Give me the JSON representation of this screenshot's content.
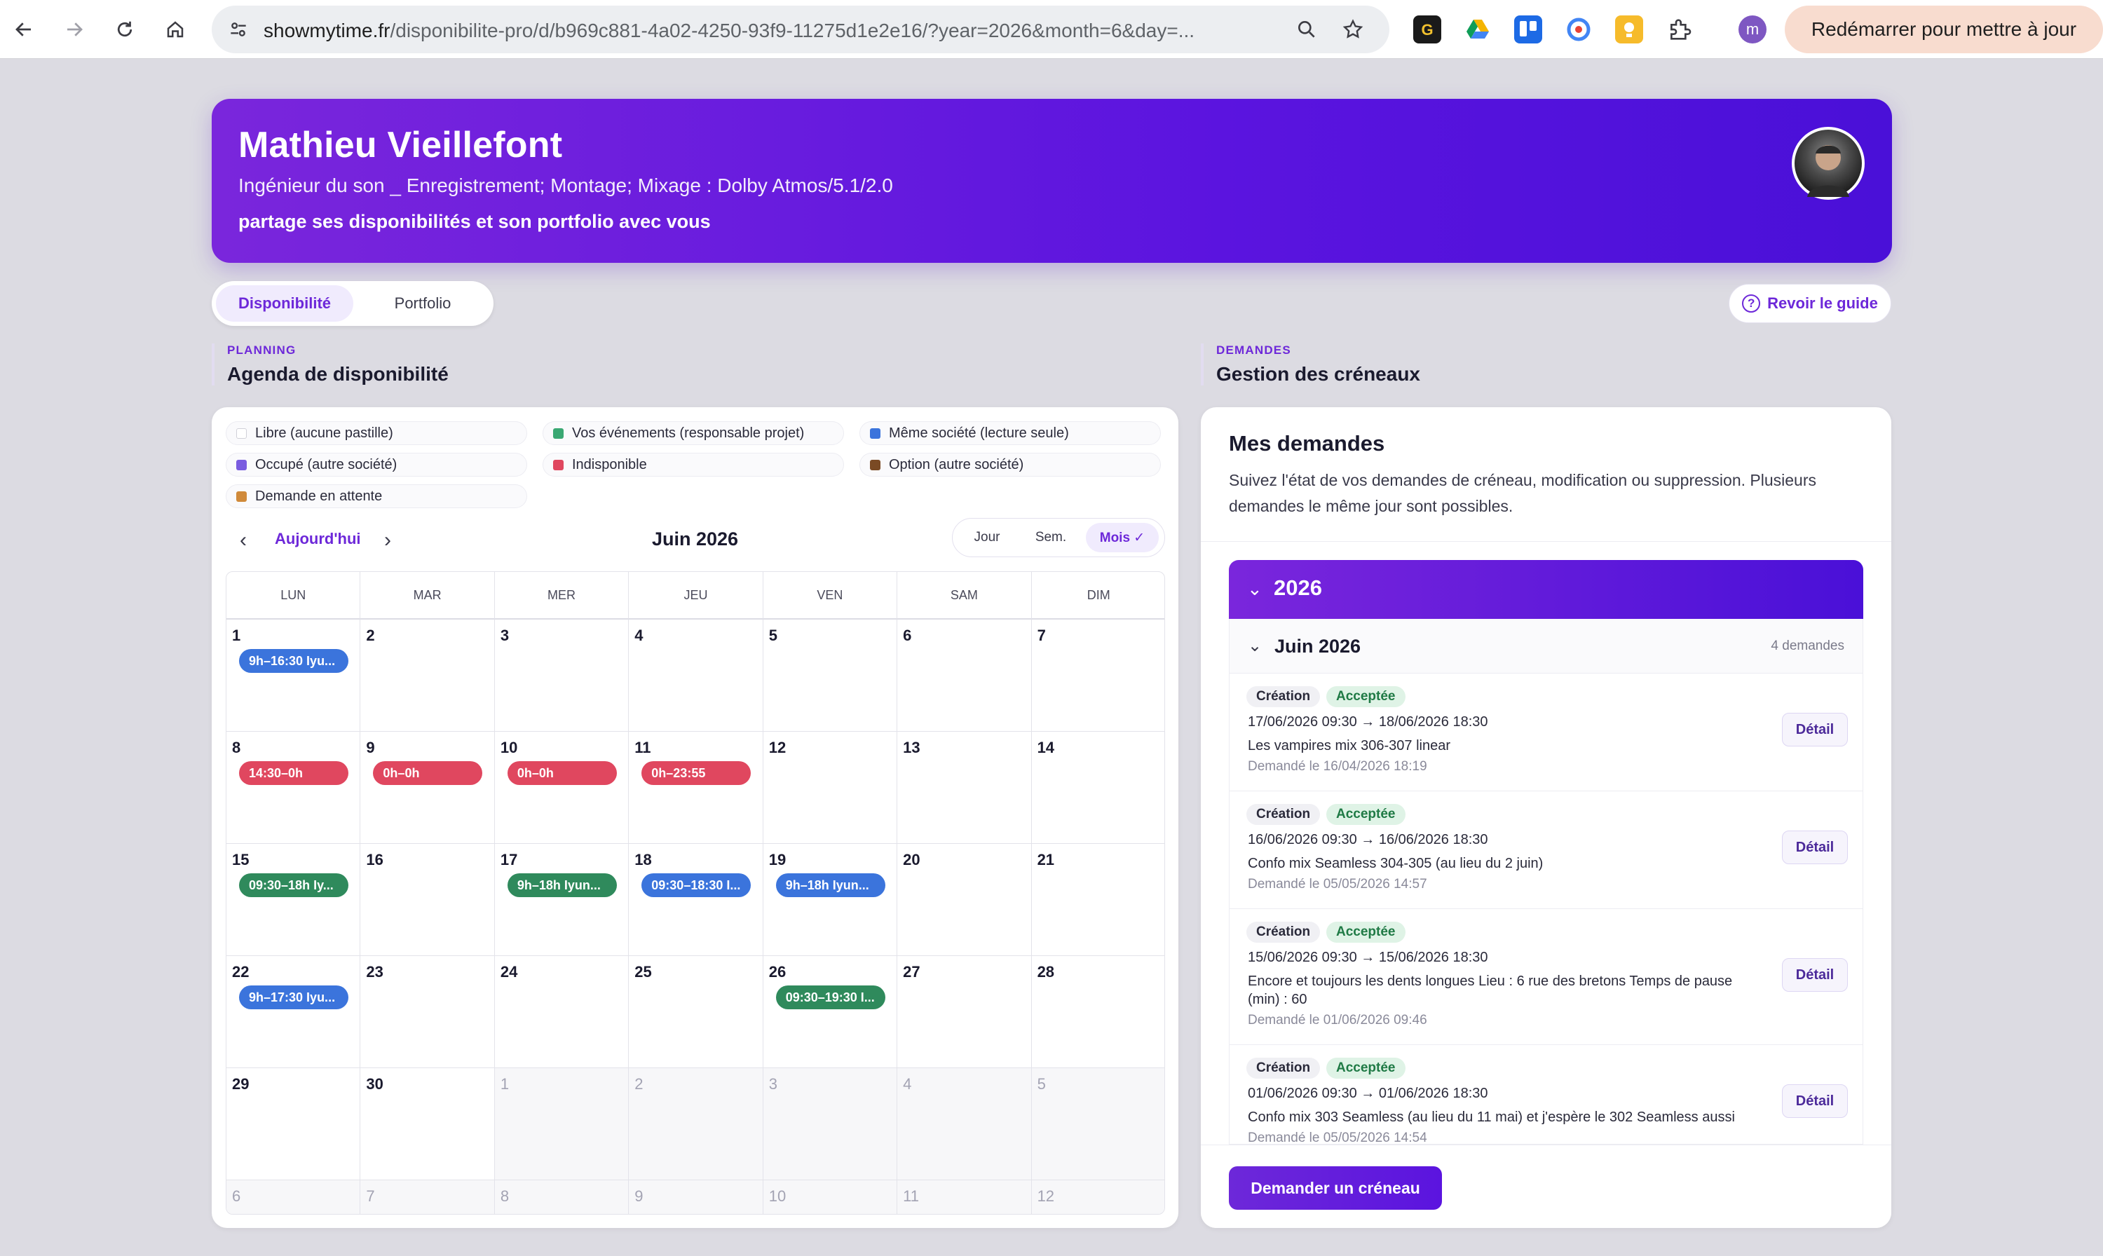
{
  "browser": {
    "url_host": "showmytime.fr",
    "url_rest": "/disponibilite-pro/d/b969c881-4a02-4250-93f9-11275d1e2e16/?year=2026&month=6&day=...",
    "update_label": "Redémarrer pour mettre à jour",
    "profile_initial": "m"
  },
  "profile": {
    "name": "Mathieu Vieillefont",
    "title": "Ingénieur du son _ Enregistrement; Montage; Mixage : Dolby Atmos/5.1/2.0",
    "share": "partage ses disponibilités et son portfolio avec vous"
  },
  "tabs": {
    "availability": "Disponibilité",
    "portfolio": "Portfolio"
  },
  "guide_label": "Revoir le guide",
  "planning": {
    "kicker": "PLANNING",
    "title": "Agenda de disponibilité"
  },
  "demandes": {
    "kicker": "DEMANDES",
    "title": "Gestion des créneaux"
  },
  "legend": [
    {
      "label": "Libre (aucune pastille)",
      "color": "#ffffff"
    },
    {
      "label": "Vos événements (responsable projet)",
      "color": "#3aa873"
    },
    {
      "label": "Même société (lecture seule)",
      "color": "#3b74dc"
    },
    {
      "label": "Occupé (autre société)",
      "color": "#7a5ce0"
    },
    {
      "label": "Indisponible",
      "color": "#e0475f"
    },
    {
      "label": "Option (autre société)",
      "color": "#7a4a24"
    },
    {
      "label": "Demande en attente",
      "color": "#d08a3a"
    }
  ],
  "calendar": {
    "today_label": "Aujourd'hui",
    "month_label": "Juin 2026",
    "modes": [
      "Jour",
      "Sem.",
      "Mois ✓"
    ],
    "weekdays": [
      "LUN",
      "MAR",
      "MER",
      "JEU",
      "VEN",
      "SAM",
      "DIM"
    ],
    "weeks": [
      [
        {
          "d": "1",
          "ev": "9h–16:30 Iyu...",
          "c": "blue"
        },
        {
          "d": "2"
        },
        {
          "d": "3"
        },
        {
          "d": "4"
        },
        {
          "d": "5"
        },
        {
          "d": "6"
        },
        {
          "d": "7"
        }
      ],
      [
        {
          "d": "8",
          "ev": "14:30–0h",
          "c": "red"
        },
        {
          "d": "9",
          "ev": "0h–0h",
          "c": "red"
        },
        {
          "d": "10",
          "ev": "0h–0h",
          "c": "red"
        },
        {
          "d": "11",
          "ev": "0h–23:55",
          "c": "red"
        },
        {
          "d": "12"
        },
        {
          "d": "13"
        },
        {
          "d": "14"
        }
      ],
      [
        {
          "d": "15",
          "ev": "09:30–18h Iy...",
          "c": "green"
        },
        {
          "d": "16"
        },
        {
          "d": "17",
          "ev": "9h–18h Iyun...",
          "c": "green"
        },
        {
          "d": "18",
          "ev": "09:30–18:30 I...",
          "c": "blue"
        },
        {
          "d": "19",
          "ev": "9h–18h Iyun...",
          "c": "blue"
        },
        {
          "d": "20"
        },
        {
          "d": "21"
        }
      ],
      [
        {
          "d": "22",
          "ev": "9h–17:30 Iyu...",
          "c": "blue"
        },
        {
          "d": "23"
        },
        {
          "d": "24"
        },
        {
          "d": "25"
        },
        {
          "d": "26",
          "ev": "09:30–19:30 I...",
          "c": "green"
        },
        {
          "d": "27"
        },
        {
          "d": "28"
        }
      ],
      [
        {
          "d": "29"
        },
        {
          "d": "30"
        },
        {
          "d": "1",
          "out": true
        },
        {
          "d": "2",
          "out": true
        },
        {
          "d": "3",
          "out": true
        },
        {
          "d": "4",
          "out": true
        },
        {
          "d": "5",
          "out": true
        }
      ],
      [
        {
          "d": "6",
          "out": true
        },
        {
          "d": "7",
          "out": true
        },
        {
          "d": "8",
          "out": true
        },
        {
          "d": "9",
          "out": true
        },
        {
          "d": "10",
          "out": true
        },
        {
          "d": "11",
          "out": true
        },
        {
          "d": "12",
          "out": true
        }
      ]
    ]
  },
  "requests": {
    "title": "Mes demandes",
    "subtitle": "Suivez l'état de vos demandes de créneau, modification ou suppression. Plusieurs demandes le même jour sont possibles.",
    "year": "2026",
    "month": "Juin 2026",
    "count_label": "4 demandes",
    "detail_label": "Détail",
    "items": [
      {
        "kind": "Création",
        "status": "Acceptée",
        "dates": "17/06/2026 09:30 → 18/06/2026 18:30",
        "desc": "Les vampires mix 306-307 linear",
        "meta": "Demandé le 16/04/2026 18:19"
      },
      {
        "kind": "Création",
        "status": "Acceptée",
        "dates": "16/06/2026 09:30 → 16/06/2026 18:30",
        "desc": "Confo mix Seamless 304-305 (au lieu du 2 juin)",
        "meta": "Demandé le 05/05/2026 14:57"
      },
      {
        "kind": "Création",
        "status": "Acceptée",
        "dates": "15/06/2026 09:30 → 15/06/2026 18:30",
        "desc": "Encore et toujours les dents longues Lieu : 6 rue des bretons Temps de pause (min) : 60",
        "meta": "Demandé le 01/06/2026 09:46"
      },
      {
        "kind": "Création",
        "status": "Acceptée",
        "dates": "01/06/2026 09:30 → 01/06/2026 18:30",
        "desc": "Confo mix 303 Seamless (au lieu du 11 mai) et j'espère le 302 Seamless aussi",
        "meta": "Demandé le 05/05/2026 14:54"
      }
    ],
    "ask_label": "Demander un créneau"
  }
}
